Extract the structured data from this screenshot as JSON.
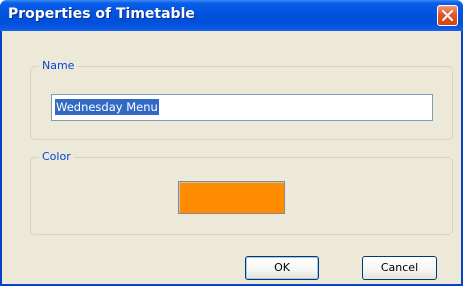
{
  "window": {
    "title": "Properties of Timetable"
  },
  "name_group": {
    "label": "Name",
    "value": "Wednesday Menu"
  },
  "color_group": {
    "label": "Color",
    "swatch_color": "#ff8c00"
  },
  "buttons": {
    "ok_label": "OK",
    "cancel_label": "Cancel"
  },
  "icons": {
    "close": "close-icon"
  },
  "colors": {
    "titlebar": "#0053e0",
    "dialog_bg": "#ece9d8",
    "group_label": "#0046d5",
    "selection": "#316ac5"
  }
}
